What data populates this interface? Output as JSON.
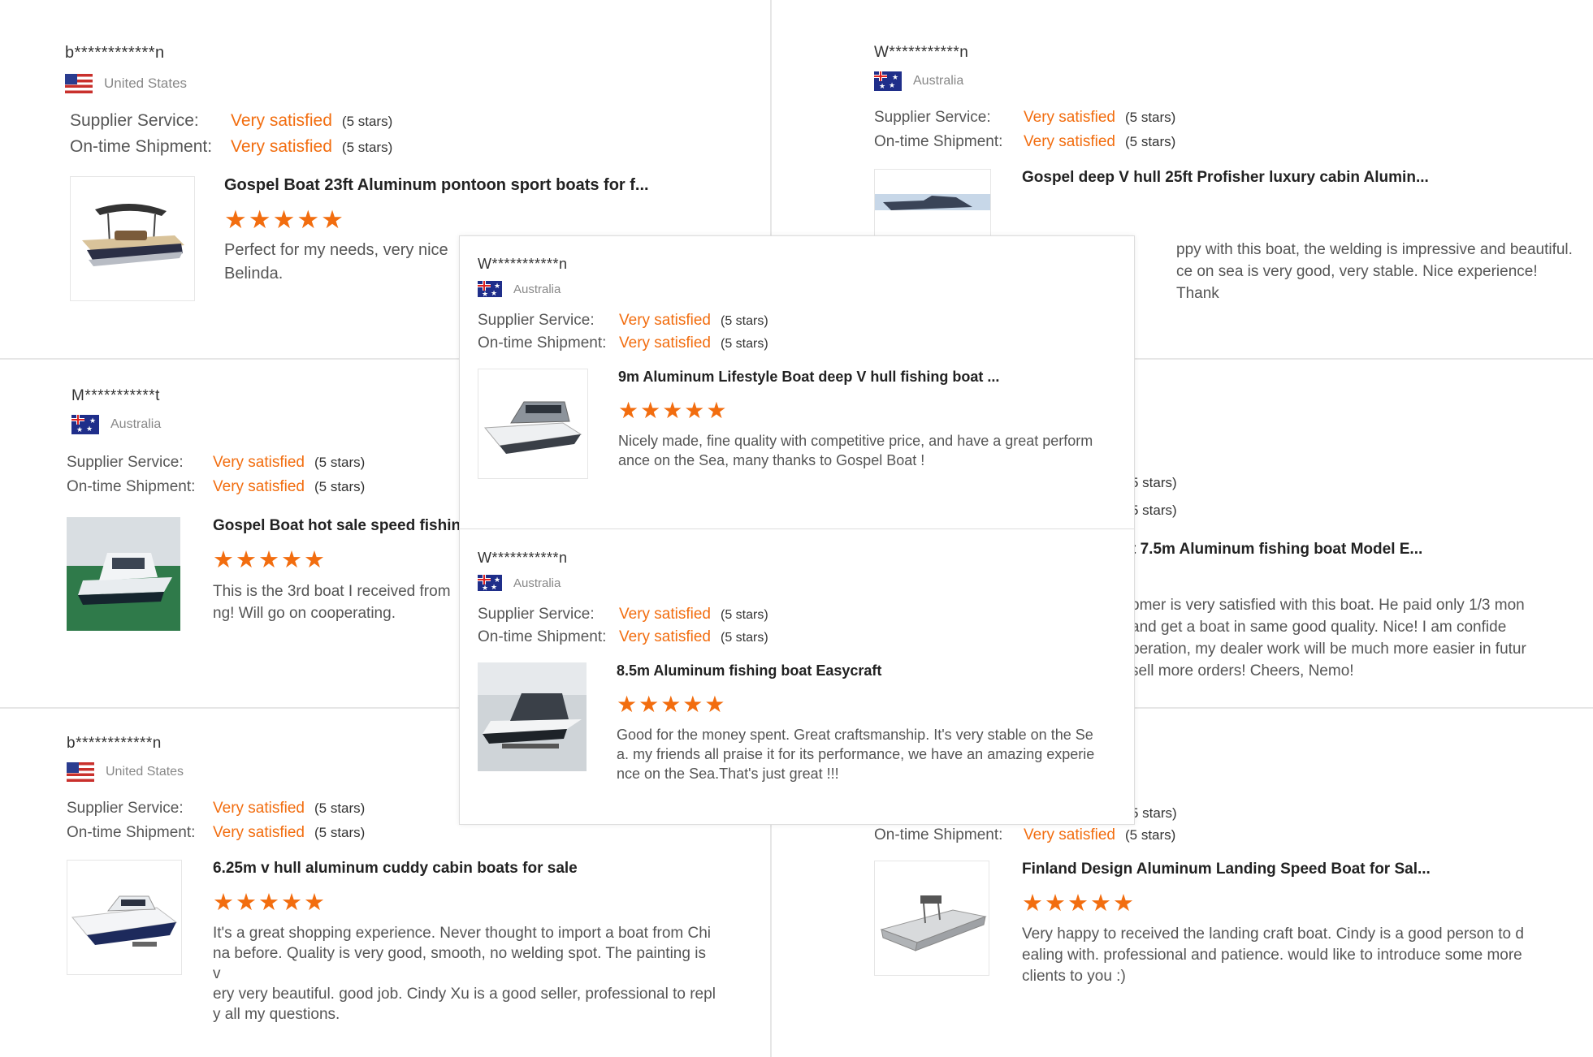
{
  "reviews": [
    {
      "user": "b************n",
      "country": "United States",
      "flag": "us",
      "supplier_label": "Supplier Service:",
      "supplier_value": "Very satisfied",
      "supplier_stars": "(5 stars)",
      "shipment_label": "On-time Shipment:",
      "shipment_value": "Very satisfied",
      "shipment_stars": "(5 stars)",
      "product_title": "Gospel Boat 23ft Aluminum pontoon sport boats for f...",
      "stars": "★★★★★",
      "text": "Perfect for my needs, very nice",
      "text2": "Belinda."
    },
    {
      "user": "W***********n",
      "country": "Australia",
      "flag": "au",
      "supplier_label": "Supplier Service:",
      "supplier_value": "Very satisfied",
      "supplier_stars": "(5 stars)",
      "shipment_label": "On-time Shipment:",
      "shipment_value": "Very satisfied",
      "shipment_stars": "(5 stars)",
      "product_title": "Gospel deep V hull 25ft Profisher luxury cabin Alumin...",
      "text": "ppy with this boat, the welding is impressive and beautiful.",
      "text2": "ce on sea is very good, very stable. Nice experience! Thank"
    },
    {
      "user": "M***********t",
      "country": "Australia",
      "flag": "au",
      "supplier_label": "Supplier Service:",
      "supplier_value": "Very satisfied",
      "supplier_stars": "(5 stars)",
      "shipment_label": "On-time Shipment:",
      "shipment_value": "Very satisfied",
      "shipment_stars": "(5 stars)",
      "product_title": "Gospel Boat hot sale speed fishing",
      "stars": "★★★★★",
      "text": "This is the 3rd boat I received from",
      "text2": "ng! Will go on cooperating."
    },
    {
      "supplier_stars": "5 stars)",
      "shipment_stars": "5 stars)",
      "product_title": "t 7.5m Aluminum fishing boat Model E...",
      "text": "omer is very satisfied with this boat. He paid only 1/3 mon",
      "text2": " and get a boat in same good quality. Nice!   I am confide",
      "text3": "peration, my dealer work will be much more easier in futur",
      "text4": "sell more orders! Cheers, Nemo!"
    },
    {
      "user": "b************n",
      "country": "United States",
      "flag": "us",
      "supplier_label": "Supplier Service:",
      "supplier_value": "Very satisfied",
      "supplier_stars": "(5 stars)",
      "shipment_label": "On-time Shipment:",
      "shipment_value": "Very satisfied",
      "shipment_stars": "(5 stars)",
      "product_title": "6.25m v hull aluminum cuddy cabin boats for sale",
      "stars": "★★★★★",
      "text": "It's a great shopping experience. Never thought to import a boat from Chi",
      "text2": "na before. Quality is very good, smooth, no welding spot. The painting is v",
      "text3": "ery very beautiful. good job. Cindy Xu is a good seller, professional to repl",
      "text4": "y all my questions."
    },
    {
      "supplier_stars": "5 stars)",
      "shipment_label": "On-time Shipment:",
      "shipment_value": "Very satisfied",
      "shipment_stars": "(5 stars)",
      "product_title": "Finland Design Aluminum Landing Speed Boat for Sal...",
      "stars": "★★★★★",
      "text": "Very happy to received the landing craft boat. Cindy is a good person to d",
      "text2": "ealing with. professional and patience. would like to introduce some more",
      "text3": "clients to you :)"
    }
  ],
  "popup": [
    {
      "user": "W***********n",
      "country": "Australia",
      "flag": "au",
      "supplier_label": "Supplier Service:",
      "supplier_value": "Very satisfied",
      "supplier_stars": "(5 stars)",
      "shipment_label": "On-time Shipment:",
      "shipment_value": "Very satisfied",
      "shipment_stars": "(5 stars)",
      "product_title": "9m Aluminum Lifestyle Boat deep V hull fishing boat ...",
      "stars": "★★★★★",
      "text": "Nicely made, fine quality with competitive price,  and have a great perform",
      "text2": "ance on the Sea, many thanks to Gospel Boat !"
    },
    {
      "user": "W***********n",
      "country": "Australia",
      "flag": "au",
      "supplier_label": "Supplier Service:",
      "supplier_value": "Very satisfied",
      "supplier_stars": "(5 stars)",
      "shipment_label": "On-time Shipment:",
      "shipment_value": "Very satisfied",
      "shipment_stars": "(5 stars)",
      "product_title": "8.5m Aluminum fishing boat Easycraft",
      "stars": "★★★★★",
      "text": "Good for the money spent. Great craftsmanship. It's very stable on the Se",
      "text2": "a. my friends all praise it for its performance, we have an amazing experie",
      "text3": "nce on the Sea.That's just great !!!"
    }
  ],
  "colors": {
    "accent": "#f26d0f",
    "divider": "#e6e6e6"
  }
}
